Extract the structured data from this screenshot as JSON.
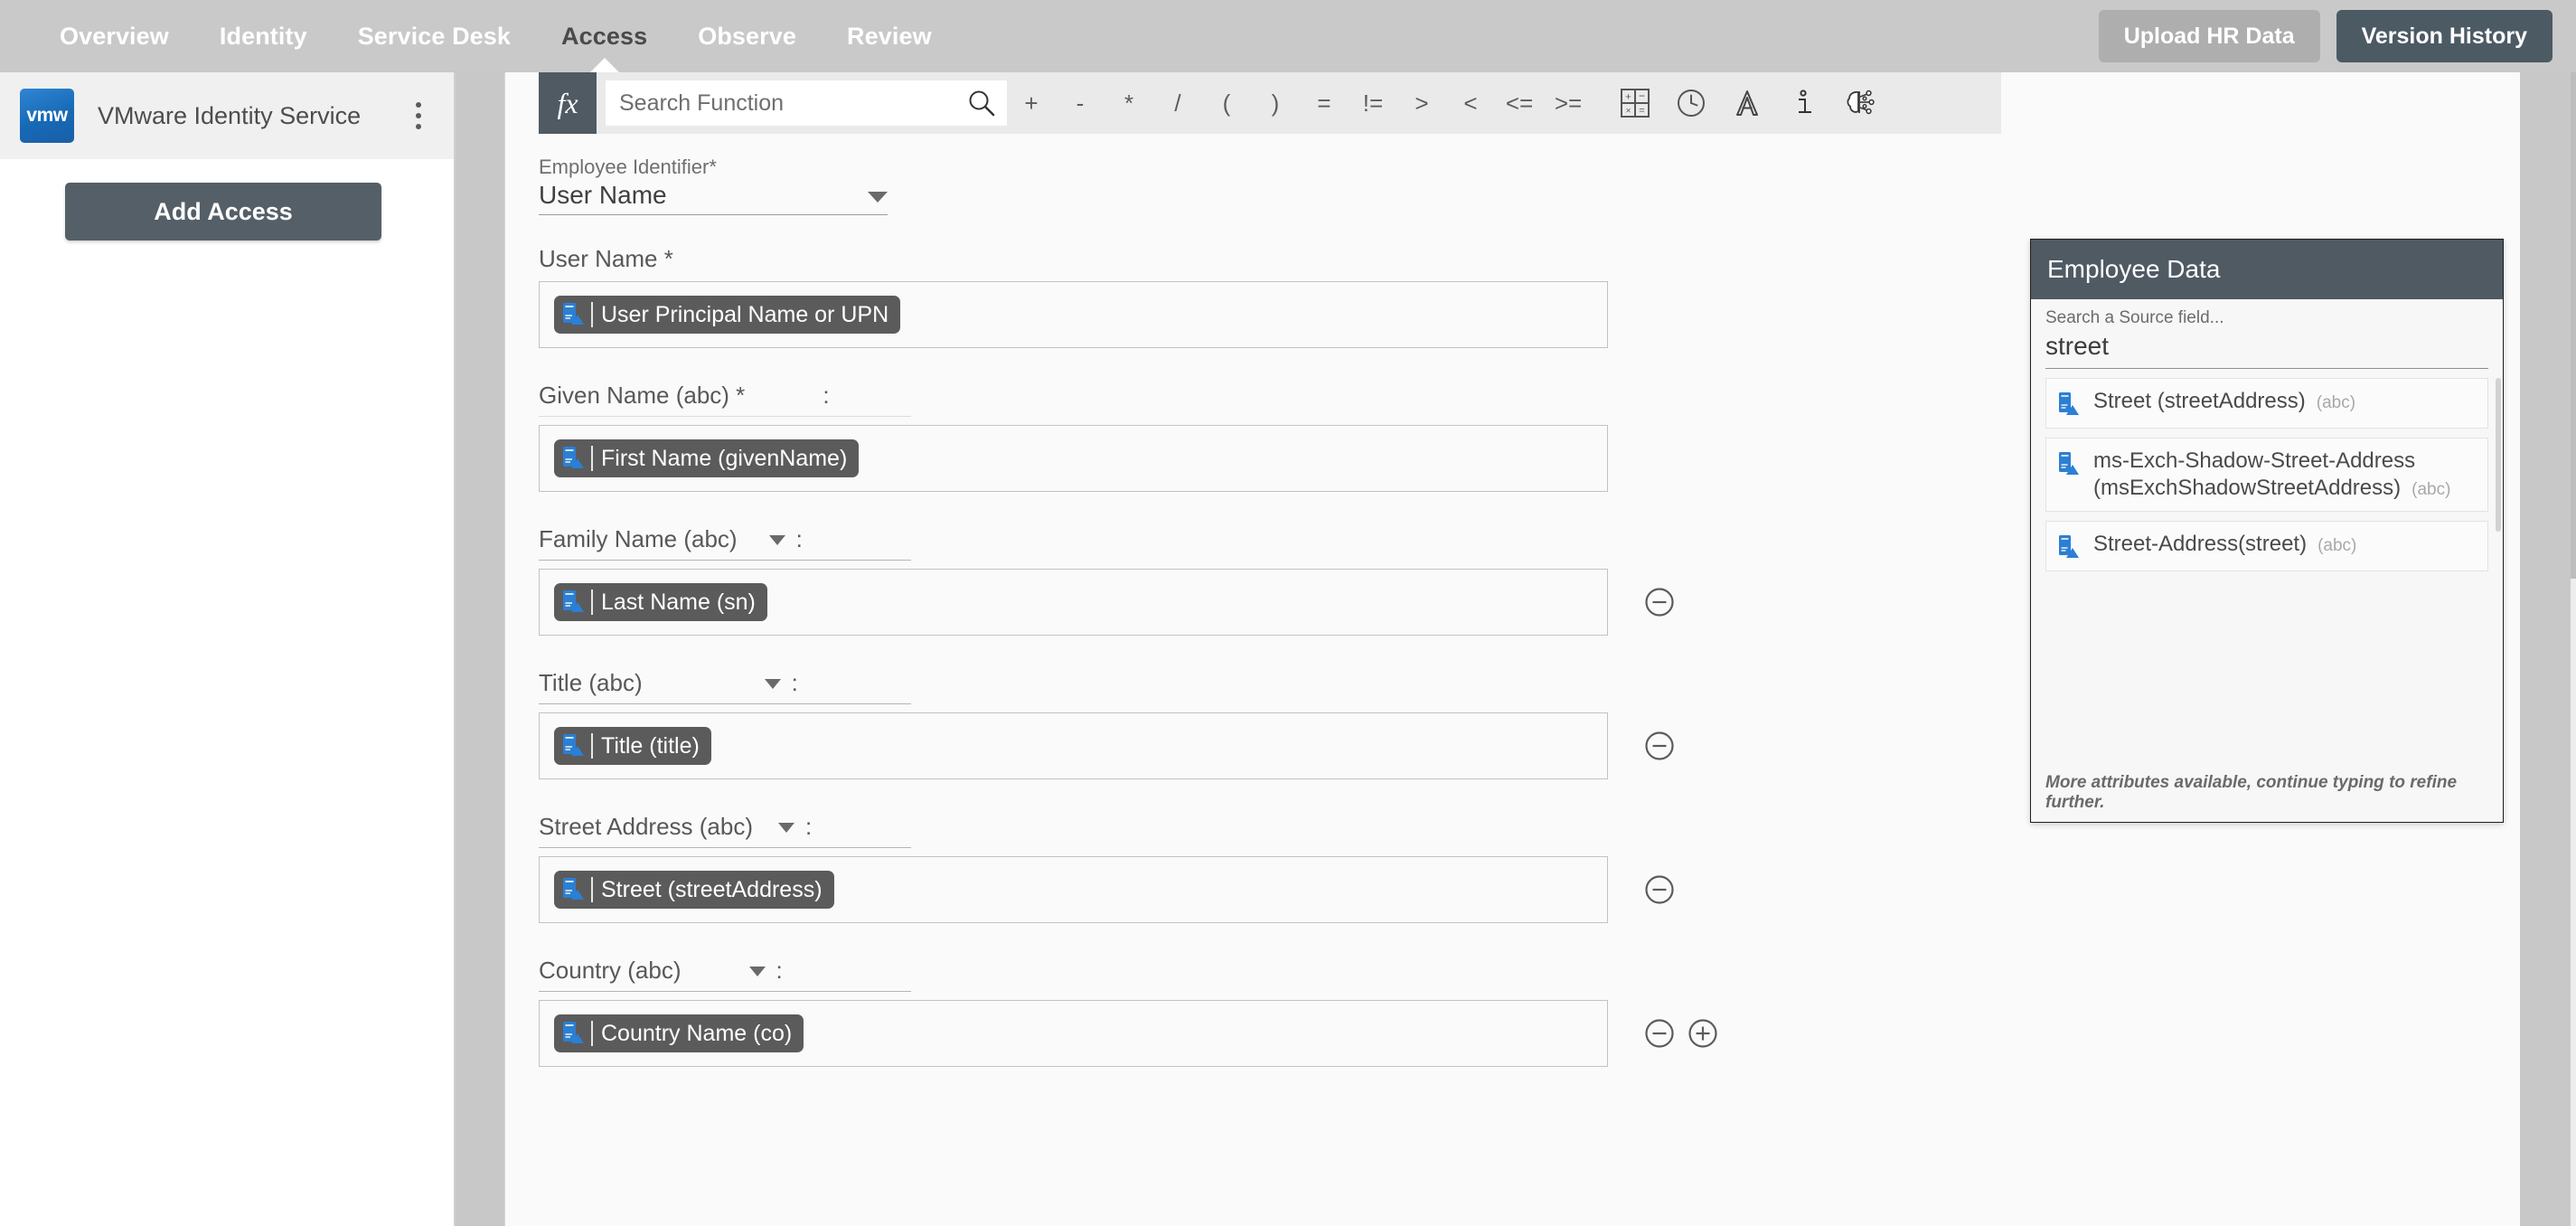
{
  "topnav": {
    "items": [
      {
        "label": "Overview",
        "active": false
      },
      {
        "label": "Identity",
        "active": false
      },
      {
        "label": "Service Desk",
        "active": false
      },
      {
        "label": "Access",
        "active": true
      },
      {
        "label": "Observe",
        "active": false
      },
      {
        "label": "Review",
        "active": false
      }
    ],
    "upload_label": "Upload HR Data",
    "version_label": "Version History",
    "bg_color": "#c9c9c9",
    "active_color": "#4a4a4a",
    "version_btn_color": "#4c5a64",
    "upload_btn_color": "#aeaeae"
  },
  "sidebar": {
    "logo_text": "vmw",
    "app_name": "VMware Identity Service",
    "kebab_icon": "more-vertical-icon",
    "add_access_label": "Add Access",
    "add_access_color": "#555f67"
  },
  "toolbar": {
    "fx_label": "fx",
    "search_placeholder": "Search Function",
    "search_value": "",
    "search_icon": "search-icon",
    "operators": [
      "+",
      "-",
      "*",
      "/",
      "(",
      ")",
      "=",
      "!=",
      ">",
      "<",
      "<=",
      ">="
    ],
    "icons": [
      {
        "name": "calculator-icon",
        "title": "Math"
      },
      {
        "name": "clock-icon",
        "title": "Date & Time"
      },
      {
        "name": "text-a-icon",
        "title": "Text"
      },
      {
        "name": "info-icon",
        "title": "Info"
      },
      {
        "name": "brain-ai-icon",
        "title": "AI"
      }
    ]
  },
  "form": {
    "identifier": {
      "label": "Employee Identifier*",
      "value": "User Name",
      "caret_icon": "chevron-down-icon"
    },
    "rows": [
      {
        "label": "User Name *",
        "has_caret": false,
        "has_colon": false,
        "underline": "none",
        "chip": {
          "text": "User Principal Name or UPN",
          "icon": "attribute-icon"
        },
        "minus": false,
        "plus": false
      },
      {
        "label": "Given Name (abc) *",
        "has_caret": false,
        "has_colon": true,
        "underline": "faint",
        "chip": {
          "text": "First Name (givenName)",
          "icon": "attribute-icon"
        },
        "minus": false,
        "plus": false
      },
      {
        "label": "Family Name (abc)",
        "has_caret": true,
        "has_colon": true,
        "underline": "solid",
        "chip": {
          "text": "Last Name (sn)",
          "icon": "attribute-icon"
        },
        "minus": true,
        "plus": false
      },
      {
        "label": "Title (abc)",
        "has_caret": true,
        "has_colon": true,
        "underline": "solid",
        "chip": {
          "text": "Title (title)",
          "icon": "attribute-icon"
        },
        "minus": true,
        "plus": false
      },
      {
        "label": "Street Address (abc)",
        "has_caret": true,
        "has_colon": true,
        "underline": "solid",
        "chip": {
          "text": "Street (streetAddress)",
          "icon": "attribute-icon"
        },
        "minus": true,
        "plus": false
      },
      {
        "label": "Country (abc)",
        "has_caret": true,
        "has_colon": true,
        "underline": "solid",
        "chip": {
          "text": "Country Name (co)",
          "icon": "attribute-icon"
        },
        "minus": true,
        "plus": true
      }
    ],
    "minus_icon": "minus-circle-icon",
    "plus_icon": "plus-circle-icon"
  },
  "employee_panel": {
    "title": "Employee Data",
    "header_color": "#4f5a63",
    "search_label": "Search a Source field...",
    "search_value": "street",
    "results": [
      {
        "name": "Street (streetAddress)",
        "type": "(abc)",
        "icon": "attribute-icon"
      },
      {
        "name": "ms-Exch-Shadow-Street-Address (msExchShadowStreetAddress)",
        "type": "(abc)",
        "icon": "attribute-icon"
      },
      {
        "name": "Street-Address(street)",
        "type": "(abc)",
        "icon": "attribute-icon"
      }
    ],
    "footer_note": "More attributes available, continue typing to refine further."
  }
}
